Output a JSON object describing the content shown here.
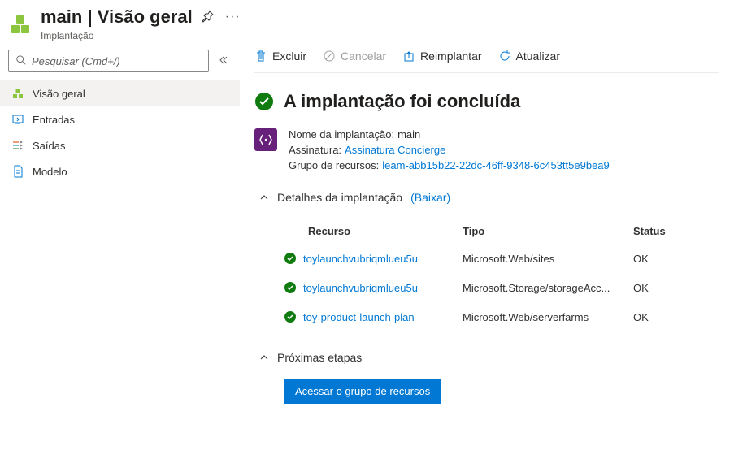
{
  "header": {
    "title": "main | Visão geral",
    "subtitle": "Implantação"
  },
  "sidebar": {
    "search_placeholder": "Pesquisar (Cmd+/)",
    "items": [
      {
        "label": "Visão geral",
        "icon": "overview-icon",
        "active": true
      },
      {
        "label": "Entradas",
        "icon": "inputs-icon",
        "active": false
      },
      {
        "label": "Saídas",
        "icon": "outputs-icon",
        "active": false
      },
      {
        "label": "Modelo",
        "icon": "template-icon",
        "active": false
      }
    ]
  },
  "toolbar": {
    "delete": "Excluir",
    "cancel": "Cancelar",
    "redeploy": "Reimplantar",
    "refresh": "Atualizar"
  },
  "status": {
    "title": "A implantação foi concluída"
  },
  "info": {
    "name_label": "Nome da implantação:",
    "name_value": "main",
    "subscription_label": "Assinatura:",
    "subscription_value": "Assinatura Concierge",
    "rg_label": "Grupo de recursos:",
    "rg_value": "leam-abb15b22-22dc-46ff-9348-6c453tt5e9bea9"
  },
  "details": {
    "title": "Detalhes da implantação",
    "download": "(Baixar)",
    "columns": {
      "resource": "Recurso",
      "type": "Tipo",
      "status": "Status"
    },
    "rows": [
      {
        "resource": "toylaunchvubriqmlueu5u",
        "type": "Microsoft.Web/sites",
        "status": "OK"
      },
      {
        "resource": "toylaunchvubriqmlueu5u",
        "type": "Microsoft.Storage/storageAcc...",
        "status": "OK"
      },
      {
        "resource": "toy-product-launch-plan",
        "type": "Microsoft.Web/serverfarms",
        "status": "OK"
      }
    ]
  },
  "next": {
    "title": "Próximas etapas",
    "button": "Acessar o grupo de recursos"
  }
}
